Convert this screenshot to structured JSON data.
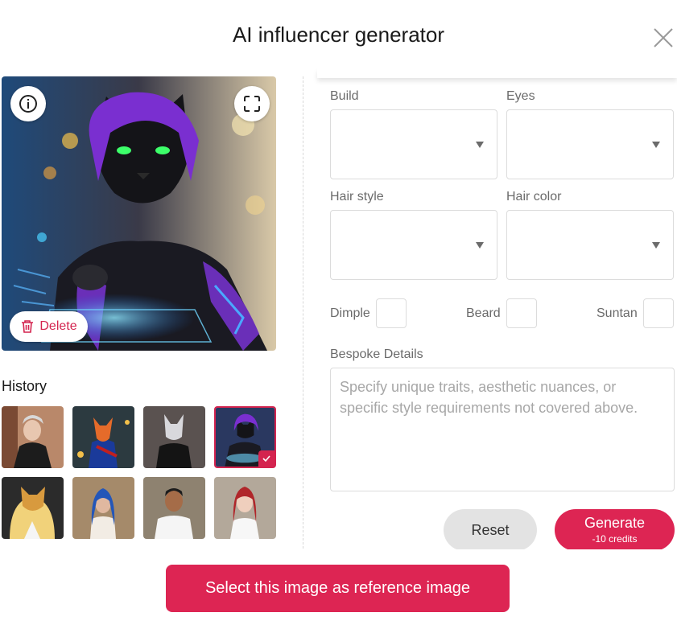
{
  "dialog": {
    "title": "AI influencer generator",
    "close_icon": "close-icon"
  },
  "preview": {
    "info_icon": "info-icon",
    "expand_icon": "fullscreen-icon",
    "delete_label": "Delete",
    "delete_icon": "trash-icon"
  },
  "history": {
    "label": "History",
    "thumbnails": [
      {
        "subject": "silver-haired man in leather jacket"
      },
      {
        "subject": "fox character with sword"
      },
      {
        "subject": "white-haired cat character"
      },
      {
        "subject": "black panther character",
        "selected": true
      },
      {
        "subject": "blonde cat character"
      },
      {
        "subject": "woman with blue hair"
      },
      {
        "subject": "man in white t-shirt"
      },
      {
        "subject": "woman with red hair"
      }
    ]
  },
  "form": {
    "build_label": "Build",
    "eyes_label": "Eyes",
    "hair_style_label": "Hair style",
    "hair_color_label": "Hair color",
    "dimple_label": "Dimple",
    "beard_label": "Beard",
    "suntan_label": "Suntan",
    "bespoke_label": "Bespoke Details",
    "bespoke_placeholder": "Specify unique traits, aesthetic nuances, or specific style requirements not covered above.",
    "build_value": "",
    "eyes_value": "",
    "hair_style_value": "",
    "hair_color_value": ""
  },
  "actions": {
    "reset_label": "Reset",
    "generate_label": "Generate",
    "generate_cost": "-10 credits",
    "select_reference_label": "Select this image as reference image"
  },
  "colors": {
    "accent": "#dd2553",
    "reset_bg": "#e3e3e3",
    "border": "#dcdcdc"
  }
}
